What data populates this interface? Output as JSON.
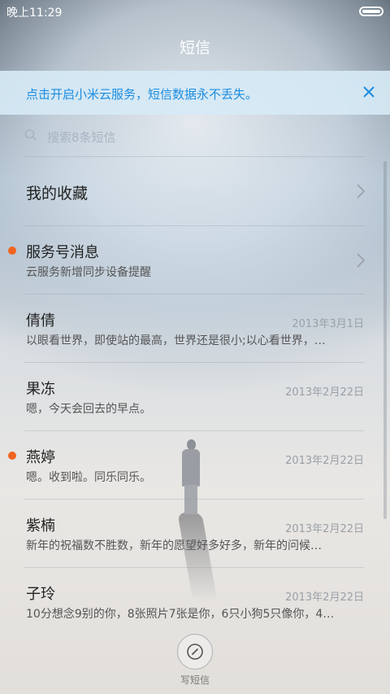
{
  "status_bar": {
    "time": "晚上11:29"
  },
  "header": {
    "title": "短信"
  },
  "notice": {
    "text": "点击开启小米云服务，短信数据永不丢失。"
  },
  "search": {
    "placeholder": "搜索8条短信"
  },
  "favorites": {
    "label": "我的收藏"
  },
  "service": {
    "title": "服务号消息",
    "subtitle": "云服务新增同步设备提醒",
    "unread": true
  },
  "conversations": [
    {
      "name": "倩倩",
      "date": "2013年3月1日",
      "preview": "以眼看世界，即使站的最高，世界还是很小;以心看世界，…",
      "unread": false
    },
    {
      "name": "果冻",
      "date": "2013年2月22日",
      "preview": "嗯，今天会回去的早点。",
      "unread": false
    },
    {
      "name": "燕婷",
      "date": "2013年2月22日",
      "preview": "嗯。收到啦。同乐同乐。",
      "unread": true
    },
    {
      "name": "紫楠",
      "date": "2013年2月22日",
      "preview": "新年的祝福数不胜数，新年的愿望好多好多，新年的问候…",
      "unread": false
    },
    {
      "name": "子玲",
      "date": "2013年2月22日",
      "preview": "10分想念9别的你，8张照片7张是你，6只小狗5只像你，4…",
      "unread": false
    }
  ],
  "compose": {
    "label": "写短信"
  },
  "colors": {
    "accent": "#1c8de0",
    "unread_dot": "#f06420"
  }
}
